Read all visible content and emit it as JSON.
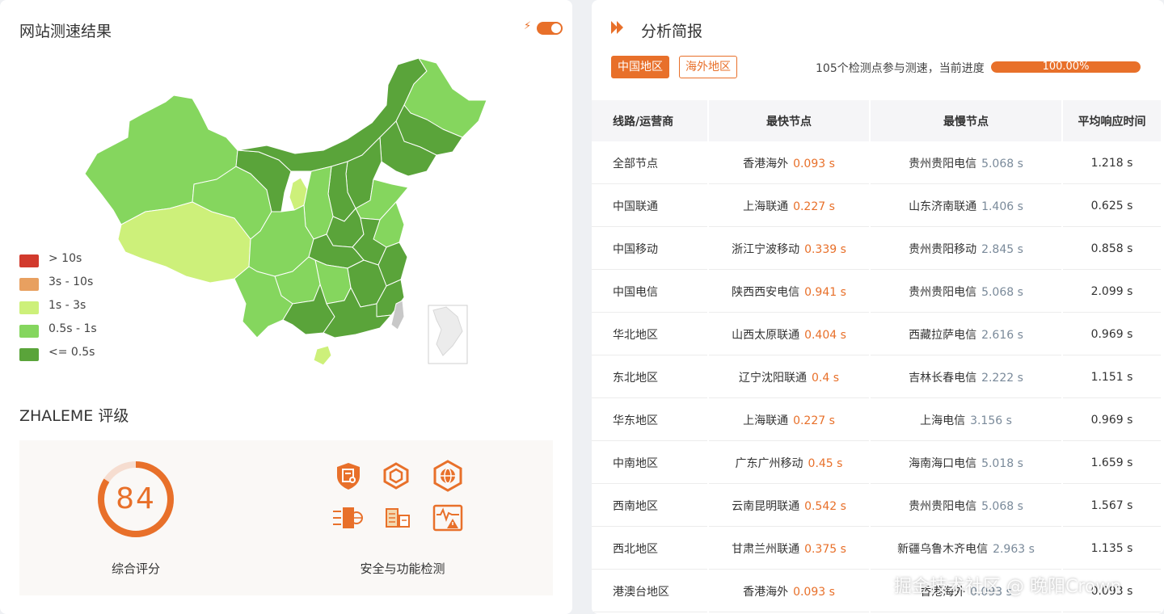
{
  "speed_test": {
    "title": "网站测速结果",
    "toggle_on": true,
    "colors": {
      "gt10": "#d23a2d",
      "s3to10": "#e8a060",
      "s1to3": "#cdf07a",
      "s05to1": "#85d65e",
      "le05": "#5aa43a"
    },
    "legend": [
      {
        "label": "> 10s",
        "color": "#d23a2d"
      },
      {
        "label": "3s - 10s",
        "color": "#e8a060"
      },
      {
        "label": "1s - 3s",
        "color": "#cdf07a"
      },
      {
        "label": "0.5s - 1s",
        "color": "#85d65e"
      },
      {
        "label": "<= 0.5s",
        "color": "#5aa43a"
      }
    ]
  },
  "rating": {
    "title": "ZHALEME 评级",
    "score": "84",
    "score_fraction": 0.84,
    "score_label": "综合评分",
    "security_label": "安全与功能检测",
    "icons": [
      "certificate-shield-icon",
      "hexagon-box-icon",
      "globe-hexagon-icon",
      "firewall-door-icon",
      "server-building-icon",
      "alert-monitor-icon"
    ]
  },
  "report": {
    "title": "分析简报",
    "tabs": [
      {
        "label": "中国地区",
        "active": true
      },
      {
        "label": "海外地区",
        "active": false
      }
    ],
    "progress_text": "105个检测点参与测速，当前进度",
    "progress_value": "100.00%",
    "progress_fraction": 1.0,
    "columns": [
      "线路/运营商",
      "最快节点",
      "最慢节点",
      "平均响应时间"
    ],
    "rows": [
      {
        "line": "全部节点",
        "fast_node": "香港海外",
        "fast_time": "0.093 s",
        "slow_node": "贵州贵阳电信",
        "slow_time": "5.068 s",
        "avg": "1.218 s"
      },
      {
        "line": "中国联通",
        "fast_node": "上海联通",
        "fast_time": "0.227 s",
        "slow_node": "山东济南联通",
        "slow_time": "1.406 s",
        "avg": "0.625 s"
      },
      {
        "line": "中国移动",
        "fast_node": "浙江宁波移动",
        "fast_time": "0.339 s",
        "slow_node": "贵州贵阳移动",
        "slow_time": "2.845 s",
        "avg": "0.858 s"
      },
      {
        "line": "中国电信",
        "fast_node": "陕西西安电信",
        "fast_time": "0.941 s",
        "slow_node": "贵州贵阳电信",
        "slow_time": "5.068 s",
        "avg": "2.099 s"
      },
      {
        "line": "华北地区",
        "fast_node": "山西太原联通",
        "fast_time": "0.404 s",
        "slow_node": "西藏拉萨电信",
        "slow_time": "2.616 s",
        "avg": "0.969 s"
      },
      {
        "line": "东北地区",
        "fast_node": "辽宁沈阳联通",
        "fast_time": "0.4 s",
        "slow_node": "吉林长春电信",
        "slow_time": "2.222 s",
        "avg": "1.151 s"
      },
      {
        "line": "华东地区",
        "fast_node": "上海联通",
        "fast_time": "0.227 s",
        "slow_node": "上海电信",
        "slow_time": "3.156 s",
        "avg": "0.969 s"
      },
      {
        "line": "中南地区",
        "fast_node": "广东广州移动",
        "fast_time": "0.45 s",
        "slow_node": "海南海口电信",
        "slow_time": "5.018 s",
        "avg": "1.659 s"
      },
      {
        "line": "西南地区",
        "fast_node": "云南昆明联通",
        "fast_time": "0.542 s",
        "slow_node": "贵州贵阳电信",
        "slow_time": "5.068 s",
        "avg": "1.567 s"
      },
      {
        "line": "西北地区",
        "fast_node": "甘肃兰州联通",
        "fast_time": "0.375 s",
        "slow_node": "新疆乌鲁木齐电信",
        "slow_time": "2.963 s",
        "avg": "1.135 s"
      },
      {
        "line": "港澳台地区",
        "fast_node": "香港海外",
        "fast_time": "0.093 s",
        "slow_node": "香港海外",
        "slow_time": "0.093 s",
        "avg": "0.093 s"
      }
    ]
  },
  "watermark": "掘金技术社区 @ 晚阳Crown"
}
